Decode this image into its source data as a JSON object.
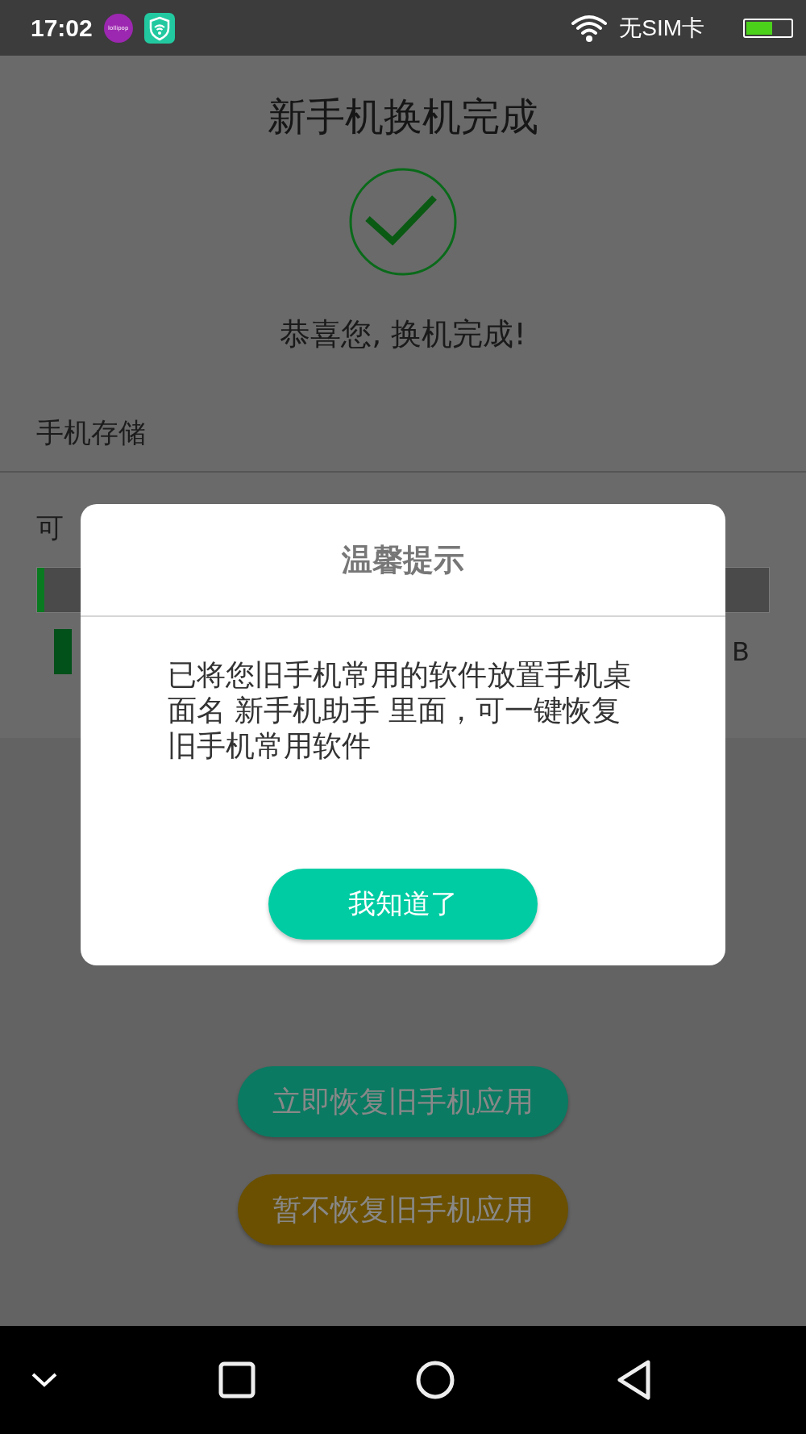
{
  "status_bar": {
    "time": "17:02",
    "app_badge": "lollipop",
    "carrier": "无SIM卡",
    "battery": {
      "level": 0.6
    }
  },
  "header": {
    "title": "新手机换机完成",
    "message": "恭喜您, 换机完成!"
  },
  "storage": {
    "heading": "手机存储",
    "available_label": "可",
    "bar": {
      "level": 0.01
    },
    "reading": "B"
  },
  "actions": [
    {
      "label": "立即恢复旧手机应用",
      "kind": "primary"
    },
    {
      "label": "暂不恢复旧手机应用",
      "kind": "secondary"
    }
  ],
  "dialog": {
    "title": "温馨提示",
    "body": "已将您旧手机常用的软件放置手机桌面名 新手机助手 里面，可一键恢复旧手机常用软件",
    "button": "我知道了"
  }
}
